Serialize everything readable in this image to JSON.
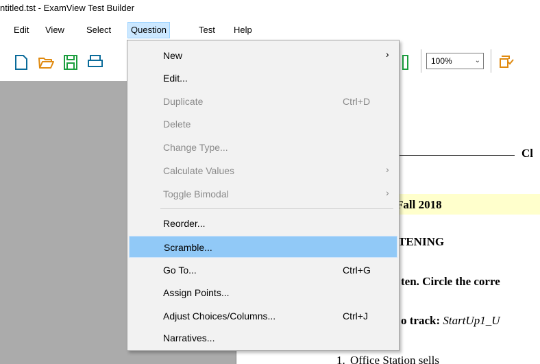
{
  "window": {
    "title": "ntitled.tst - ExamView Test Builder"
  },
  "menubar": {
    "items": [
      {
        "label": "Edit"
      },
      {
        "label": "View"
      },
      {
        "label": "Select"
      },
      {
        "label": "Question",
        "active": true
      },
      {
        "label": "Test"
      },
      {
        "label": "Help"
      }
    ]
  },
  "toolbar": {
    "zoom_value": "100%",
    "icons": [
      "new-document-icon",
      "open-folder-icon",
      "save-icon",
      "print-icon",
      "layout-icon",
      "copy-format-icon"
    ]
  },
  "question_menu": {
    "items": [
      {
        "label": "New",
        "shortcut": "",
        "submenu": true,
        "enabled": true
      },
      {
        "label": "Edit...",
        "shortcut": "",
        "submenu": false,
        "enabled": true
      },
      {
        "label": "Duplicate",
        "shortcut": "Ctrl+D",
        "submenu": false,
        "enabled": false
      },
      {
        "label": "Delete",
        "shortcut": "",
        "submenu": false,
        "enabled": false
      },
      {
        "label": "Change Type...",
        "shortcut": "",
        "submenu": false,
        "enabled": false
      },
      {
        "label": "Calculate Values",
        "shortcut": "",
        "submenu": true,
        "enabled": false
      },
      {
        "label": "Toggle Bimodal",
        "shortcut": "",
        "submenu": true,
        "enabled": false
      },
      {
        "label": "Reorder...",
        "shortcut": "",
        "submenu": false,
        "enabled": true
      },
      {
        "label": "Scramble...",
        "shortcut": "",
        "submenu": false,
        "enabled": true,
        "highlighted": true
      },
      {
        "label": "Go To...",
        "shortcut": "Ctrl+G",
        "submenu": false,
        "enabled": true
      },
      {
        "label": "Assign Points...",
        "shortcut": "",
        "submenu": false,
        "enabled": true
      },
      {
        "label": "Adjust Choices/Columns...",
        "shortcut": "Ctrl+J",
        "submenu": false,
        "enabled": true
      },
      {
        "label": "Narratives...",
        "shortcut": "",
        "submenu": false,
        "enabled": true
      }
    ]
  },
  "document": {
    "fragment_cl": "Cl",
    "fragment_fall": "Fall 2018",
    "fragment_tening": "TENING",
    "fragment_instruction": "ten. Circle the corre",
    "fragment_track_bold": "o track: ",
    "fragment_track_italic": "StartUp1_U",
    "fragment_item_number": "1.",
    "fragment_item_text": "Office Station sells"
  },
  "colors": {
    "menu_highlight": "#91c9f7",
    "menubar_active": "#cce8ff",
    "left_pane": "#ababab",
    "doc_highlight": "#ffffcc"
  }
}
